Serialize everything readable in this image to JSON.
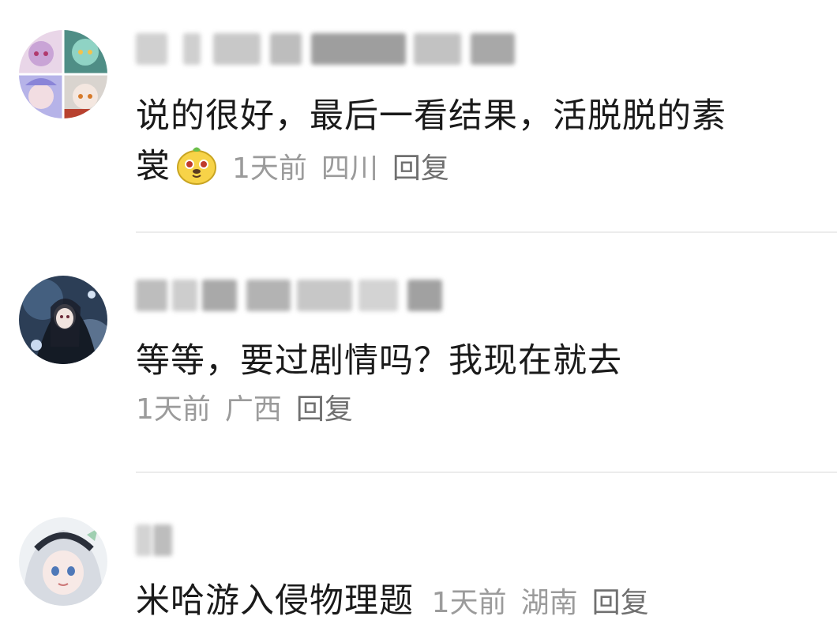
{
  "comments": [
    {
      "text_line1": "说的很好，最后一看结果，活脱脱的素",
      "text_line2": "裳",
      "time": "1天前",
      "location": "四川",
      "reply": "回复",
      "emoji": "yellow-mascot-emoji"
    },
    {
      "text": "等等，要过剧情吗？我现在就去",
      "time": "1天前",
      "location": "广西",
      "reply": "回复"
    },
    {
      "text": "米哈游入侵物理题",
      "time": "1天前",
      "location": "湖南",
      "reply": "回复"
    }
  ],
  "colors": {
    "text": "#1a1a1a",
    "meta": "#9b9b9b",
    "reply": "#707070",
    "divider": "#ececec"
  }
}
